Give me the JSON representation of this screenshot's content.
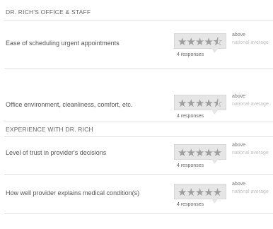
{
  "sections": [
    {
      "title": "DR. RICH'S OFFICE & STAFF",
      "rows": [
        {
          "label": "Ease of scheduling urgent appointments",
          "rating": 4.5,
          "responses": "4 responses",
          "comparison_top": "above",
          "comparison_bottom": "national average"
        },
        {
          "label": "Office environment, cleanliness, comfort, etc.",
          "rating": 4.5,
          "responses": "4 responses",
          "comparison_top": "above",
          "comparison_bottom": "national average"
        }
      ]
    },
    {
      "title": "EXPERIENCE WITH DR. RICH",
      "rows": [
        {
          "label": "Level of trust in provider's decisions",
          "rating": 5,
          "responses": "4 responses",
          "comparison_top": "above",
          "comparison_bottom": "national average"
        },
        {
          "label": "How well provider explains medical condition(s)",
          "rating": 5,
          "responses": "4 responses",
          "comparison_top": "above",
          "comparison_bottom": "national average"
        }
      ]
    }
  ],
  "icons": {
    "star": "star-icon",
    "half_star": "half-star-icon"
  }
}
